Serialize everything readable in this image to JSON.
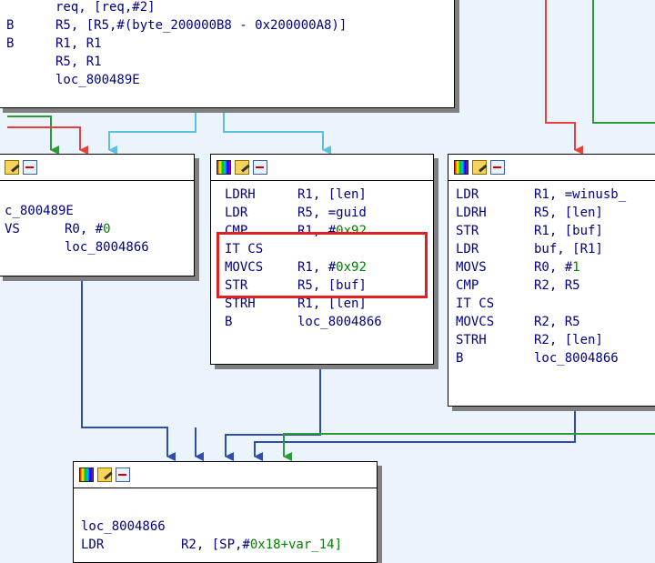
{
  "nodes": {
    "top": {
      "lines": [
        {
          "mn": "",
          "op": "req, [req,#2]",
          "num": ""
        },
        {
          "mn": "B",
          "op": "R5, [R5,#(byte_200000B8 - 0x200000A8)]",
          "num": ""
        },
        {
          "mn": "B",
          "op": "R1, R1",
          "num": ""
        },
        {
          "mn": "",
          "op": "R5, R1",
          "num": ""
        },
        {
          "mn": "",
          "op": "loc_800489E",
          "num": ""
        }
      ]
    },
    "left": {
      "lines": [
        {
          "mn": "",
          "op": "",
          "num": ""
        },
        {
          "mn": "",
          "op": "c_800489E",
          "num": ""
        },
        {
          "mn": "VS",
          "op": "R0, #",
          "num": "0"
        },
        {
          "mn": "",
          "op": "loc_8004866",
          "num": ""
        }
      ]
    },
    "mid": {
      "lines": [
        {
          "mn": "LDRH",
          "op": "R1, [len]",
          "num": ""
        },
        {
          "mn": "LDR",
          "op": "R5, =guid",
          "num": ""
        },
        {
          "mn": "CMP",
          "op": "R1, #",
          "num": "0x92"
        },
        {
          "mn": "IT CS",
          "op": "",
          "num": ""
        },
        {
          "mn": "MOVCS",
          "op": "R1, #",
          "num": "0x92"
        },
        {
          "mn": "STR",
          "op": "R5, [buf]",
          "num": ""
        },
        {
          "mn": "STRH",
          "op": "R1, [len]",
          "num": ""
        },
        {
          "mn": "B",
          "op": "loc_8004866",
          "num": ""
        }
      ]
    },
    "right": {
      "lines": [
        {
          "mn": "LDR",
          "op": "R1, =winusb_",
          "num": ""
        },
        {
          "mn": "LDRH",
          "op": "R5, [len]",
          "num": ""
        },
        {
          "mn": "STR",
          "op": "R1, [buf]",
          "num": ""
        },
        {
          "mn": "LDR",
          "op": "buf, [R1]",
          "num": ""
        },
        {
          "mn": "MOVS",
          "op": "R0, #",
          "num": "1"
        },
        {
          "mn": "CMP",
          "op": "R2, R5",
          "num": ""
        },
        {
          "mn": "IT CS",
          "op": "",
          "num": ""
        },
        {
          "mn": "MOVCS",
          "op": "R2, R5",
          "num": ""
        },
        {
          "mn": "STRH",
          "op": "R2, [len]",
          "num": ""
        },
        {
          "mn": "B",
          "op": "loc_8004866",
          "num": ""
        }
      ]
    },
    "bottom": {
      "lines": [
        {
          "mn": "",
          "op": "",
          "num": ""
        },
        {
          "mn": "",
          "op": "",
          "num": ""
        },
        {
          "mn": "loc_8004866",
          "op": "",
          "num": ""
        },
        {
          "mn": "LDR",
          "op": "R2, [SP,#",
          "num": "0x18+var_14]"
        }
      ]
    }
  },
  "colors": {
    "background": "#ebf4fd",
    "edge_blue": "#2e4ea8",
    "edge_cyan": "#5bc0de",
    "edge_red": "#e8413d",
    "edge_green": "#2c9a3c",
    "highlight": "#e02020",
    "numeric": "#008000"
  },
  "icons": [
    "palette-icon",
    "pencil-edit-icon",
    "graph-view-icon"
  ]
}
